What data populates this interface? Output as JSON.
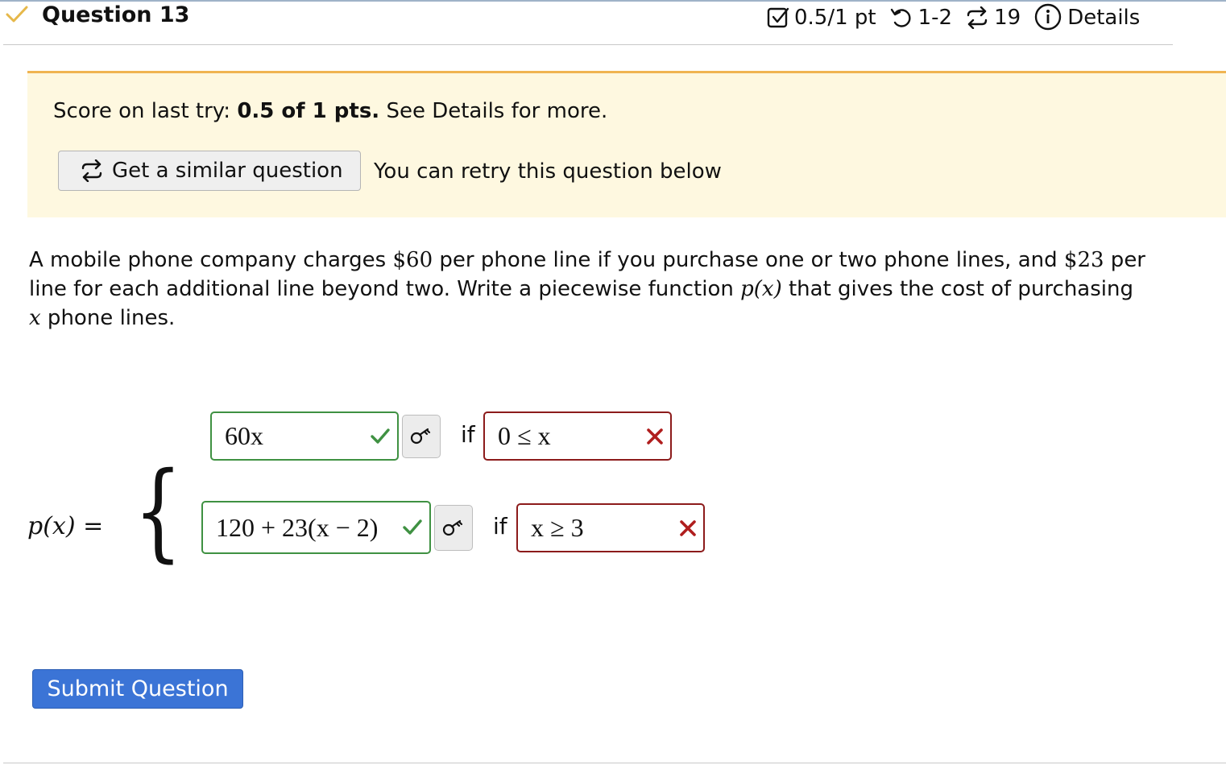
{
  "header": {
    "question_title": "Question 13",
    "score": "0.5/1 pt",
    "attempts": "1-2",
    "similar_count": "19",
    "details_label": "Details"
  },
  "banner": {
    "score_prefix": "Score on last try: ",
    "score_value": "0.5 of 1 pts.",
    "score_suffix": " See Details for more.",
    "similar_button_label": "Get a similar question",
    "retry_text": "You can retry this question below"
  },
  "problem": {
    "line1_a": "A mobile phone company charges ",
    "price1": "$60",
    "line1_b": " per phone line if you purchase one or two phone lines, and ",
    "price2": "$23",
    "line1_c": " per",
    "line2_a": "line for each additional line beyond two. Write a piecewise function ",
    "func": "p(x)",
    "line2_b": " that gives the cost of purchasing",
    "var": "x",
    "line3": " phone lines."
  },
  "piecewise": {
    "label": "p(x) =",
    "rows": [
      {
        "expr": "60x",
        "expr_status": "correct",
        "condition": "0 ≤ x",
        "condition_status": "incorrect",
        "if_label": "if"
      },
      {
        "expr": "120 + 23(x − 2)",
        "expr_status": "correct",
        "condition": "x ≥ 3",
        "condition_status": "incorrect",
        "if_label": "if"
      }
    ]
  },
  "submit_label": "Submit Question",
  "colors": {
    "banner_bg": "#fef8e0",
    "banner_border": "#f0b451",
    "correct": "#3f9142",
    "incorrect": "#8c1b1b",
    "submit": "#3b74d6"
  }
}
